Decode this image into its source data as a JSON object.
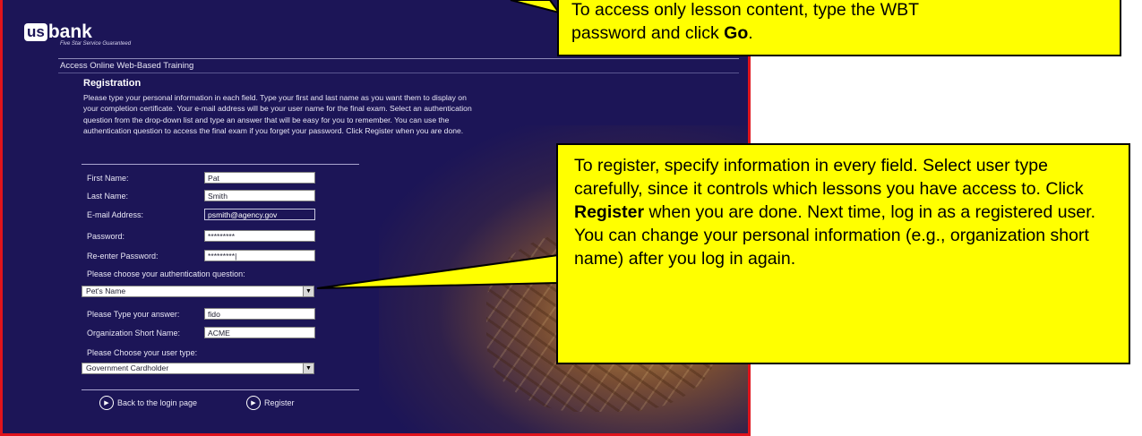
{
  "app": {
    "logo_us": "us",
    "logo_bank": "bank",
    "logo_tagline": "Five Star Service Guaranteed",
    "title": "Access Online Web-Based Training"
  },
  "registration": {
    "heading": "Registration",
    "intro": "Please type your personal information in each field. Type your first and last name as you want them to display on your completion certificate. Your e-mail address will be your user name for the final exam. Select an authentication question from the drop-down list and type an answer that will be easy for you to remember. You can use the authentication question to access the final exam if you forget your password. Click Register when you are done.",
    "fields": {
      "first_name_label": "First Name:",
      "first_name_value": "Pat",
      "last_name_label": "Last Name:",
      "last_name_value": "Smith",
      "email_label": "E-mail Address:",
      "email_value": "psmith@agency.gov",
      "password_label": "Password:",
      "password_value": "*********",
      "reenter_label": "Re-enter Password:",
      "reenter_value": "*********|",
      "auth_question_label": "Please choose your authentication question:",
      "auth_question_value": "Pet's Name",
      "answer_label": "Please Type your answer:",
      "answer_value": "fido",
      "org_label": "Organization Short Name:",
      "org_value": "ACME",
      "user_type_label": "Please Choose your user type:",
      "user_type_value": "Government Cardholder"
    },
    "back_button": "Back to the login page",
    "register_button": "Register"
  },
  "callouts": {
    "top_line1": "To access only lesson content, type the WBT",
    "top_line2_prefix": "password and click ",
    "top_line2_bold": "Go",
    "top_line2_suffix": ".",
    "main_part1": "To register, specify information in every field. Select user type carefully, since it controls which lessons you have access to. Click ",
    "main_bold": "Register",
    "main_part2": " when you are done. Next time, log in as a registered user. You can change your personal information (e.g., organization short name) after you log in again."
  },
  "colors": {
    "background": "#1c1557",
    "frame_border": "#e0141c",
    "callout": "#ffff00"
  }
}
